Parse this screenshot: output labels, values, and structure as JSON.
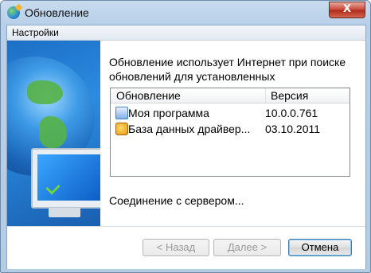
{
  "window": {
    "title": "Обновление",
    "close_label": "X"
  },
  "menu": {
    "items": [
      "Настройки"
    ]
  },
  "content": {
    "intro_text": "Обновление использует Интернет при поиске обновлений для установленных",
    "list": {
      "columns": [
        "Обновление",
        "Версия"
      ],
      "rows": [
        {
          "icon": "program-icon",
          "name": "Моя программа",
          "version": "10.0.0.761"
        },
        {
          "icon": "database-icon",
          "name": "База данных драйвер...",
          "version": "03.10.2011"
        }
      ]
    },
    "status": "Соединение с сервером..."
  },
  "buttons": {
    "back": "< Назад",
    "next": "Далее >",
    "cancel": "Отмена"
  }
}
